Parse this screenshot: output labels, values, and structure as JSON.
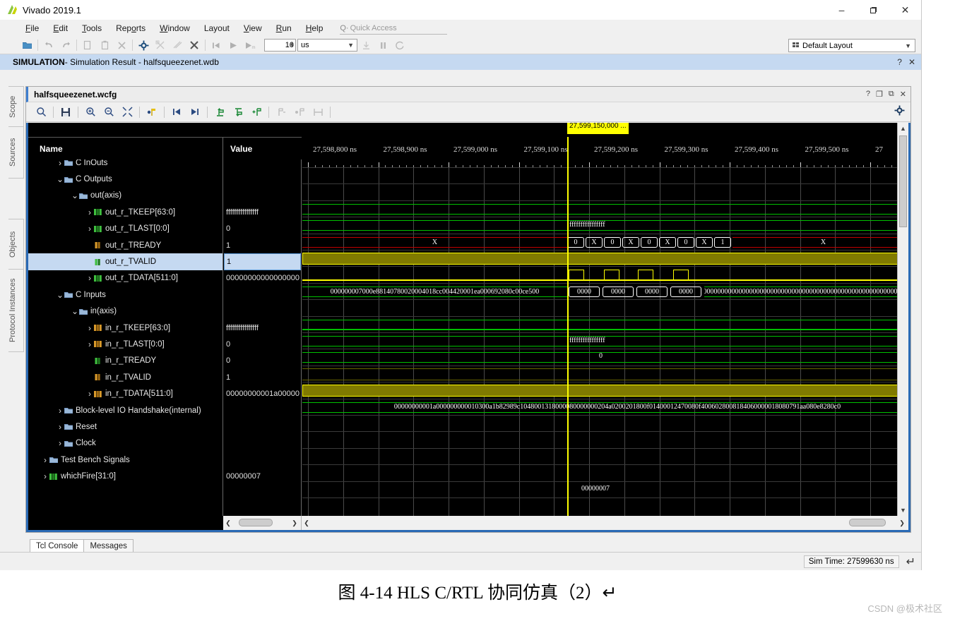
{
  "window": {
    "title": "Vivado 2019.1",
    "controls": {
      "minimize": "–",
      "maximize": "❐",
      "close": "✕"
    }
  },
  "menubar": {
    "items": [
      "File",
      "Edit",
      "Tools",
      "Reports",
      "Window",
      "Layout",
      "View",
      "Run",
      "Help"
    ],
    "quick_access_placeholder": "Quick Access"
  },
  "toolbar": {
    "time_value": "10",
    "time_unit": "us",
    "layout_label": "Default Layout"
  },
  "sim_banner": {
    "bold": "SIMULATION",
    "rest": " - Simulation Result - halfsqueezenet.wdb",
    "help": "?",
    "close": "✕"
  },
  "side_tabs": [
    "Scope",
    "Sources",
    "Objects",
    "Protocol Instances"
  ],
  "wave_window": {
    "title": "halfsqueezenet.wcfg",
    "controls": [
      "?",
      "❐",
      "⧉",
      "✕"
    ],
    "columns": {
      "name": "Name",
      "value": "Value"
    },
    "cursor_flag": "27,599,150,000 ...",
    "ruler_unit": "ns",
    "ruler_ticks": [
      "27,598,800 ns",
      "27,598,900 ns",
      "27,599,000 ns",
      "27,599,100 ns",
      "27,599,200 ns",
      "27,599,300 ns",
      "27,599,400 ns",
      "27,599,500 ns",
      "27"
    ]
  },
  "signals": [
    {
      "name": "C InOuts",
      "value": "",
      "indent": 1,
      "expand": "right",
      "icon": "group",
      "clipped": true
    },
    {
      "name": "C Outputs",
      "value": "",
      "indent": 1,
      "expand": "down",
      "icon": "group"
    },
    {
      "name": "out(axis)",
      "value": "",
      "indent": 2,
      "expand": "down",
      "icon": "group"
    },
    {
      "name": "out_r_TKEEP[63:0]",
      "value": "ffffffffffffffff",
      "indent": 3,
      "expand": "right",
      "icon": "bus-green"
    },
    {
      "name": "out_r_TLAST[0:0]",
      "value": "0",
      "indent": 3,
      "expand": "right",
      "icon": "bus-green"
    },
    {
      "name": "out_r_TREADY",
      "value": "1",
      "indent": 3,
      "expand": "none",
      "icon": "wire-orange"
    },
    {
      "name": "out_r_TVALID",
      "value": "1",
      "indent": 3,
      "expand": "none",
      "icon": "wire-green",
      "selected": true
    },
    {
      "name": "out_r_TDATA[511:0]",
      "value": "00000000000000000",
      "indent": 3,
      "expand": "right",
      "icon": "bus-green"
    },
    {
      "name": "C Inputs",
      "value": "",
      "indent": 1,
      "expand": "down",
      "icon": "group"
    },
    {
      "name": "in(axis)",
      "value": "",
      "indent": 2,
      "expand": "down",
      "icon": "group"
    },
    {
      "name": "in_r_TKEEP[63:0]",
      "value": "ffffffffffffffff",
      "indent": 3,
      "expand": "right",
      "icon": "bus-orange"
    },
    {
      "name": "in_r_TLAST[0:0]",
      "value": "0",
      "indent": 3,
      "expand": "right",
      "icon": "bus-orange"
    },
    {
      "name": "in_r_TREADY",
      "value": "0",
      "indent": 3,
      "expand": "none",
      "icon": "wire-green"
    },
    {
      "name": "in_r_TVALID",
      "value": "1",
      "indent": 3,
      "expand": "none",
      "icon": "wire-orange"
    },
    {
      "name": "in_r_TDATA[511:0]",
      "value": "00000000001a00000",
      "indent": 3,
      "expand": "right",
      "icon": "bus-orange"
    },
    {
      "name": "Block-level IO Handshake(internal)",
      "value": "",
      "indent": 1,
      "expand": "right",
      "icon": "group"
    },
    {
      "name": "Reset",
      "value": "",
      "indent": 1,
      "expand": "right",
      "icon": "group"
    },
    {
      "name": "Clock",
      "value": "",
      "indent": 1,
      "expand": "right",
      "icon": "group"
    },
    {
      "name": "Test Bench Signals",
      "value": "",
      "indent": 0,
      "expand": "right",
      "icon": "group"
    },
    {
      "name": "whichFire[31:0]",
      "value": "00000007",
      "indent": 0,
      "expand": "right",
      "icon": "bus-green"
    }
  ],
  "waveform_values": {
    "out_tkeep_after": "ffffffffffffffff",
    "out_tlast_before": "X",
    "out_tlast_sequence": [
      "0",
      "X",
      "0",
      "X",
      "0",
      "X",
      "0",
      "X",
      "1"
    ],
    "out_tlast_after": "X",
    "out_tdata_before": "000000007000e88140780020004018cc004420001ea000692080c00ce500",
    "out_tdata_pulses": [
      "0000",
      "0000",
      "0000",
      "0000"
    ],
    "out_tdata_after": "000000000000000000000000000000000000000000000000000000000000",
    "in_tkeep_after": "ffffffffffffffff",
    "in_tlast_after": "0",
    "in_tdata": "00000000001a000000000010300a1b82989c10480013180000800000002 04a0200201800f014000124700 80f40060280081840600000180807 91aa080e8280c0",
    "whichfire_value": "00000007"
  },
  "bottom_tabs": [
    {
      "label": "Tcl Console",
      "active": true
    },
    {
      "label": "Messages",
      "active": false
    }
  ],
  "status": {
    "sim_time": "Sim Time: 27599630 ns",
    "return_glyph": "↵"
  },
  "caption": "图 4-14 HLS C/RTL 协同仿真（2）↵",
  "watermark": "CSDN @极术社区"
}
